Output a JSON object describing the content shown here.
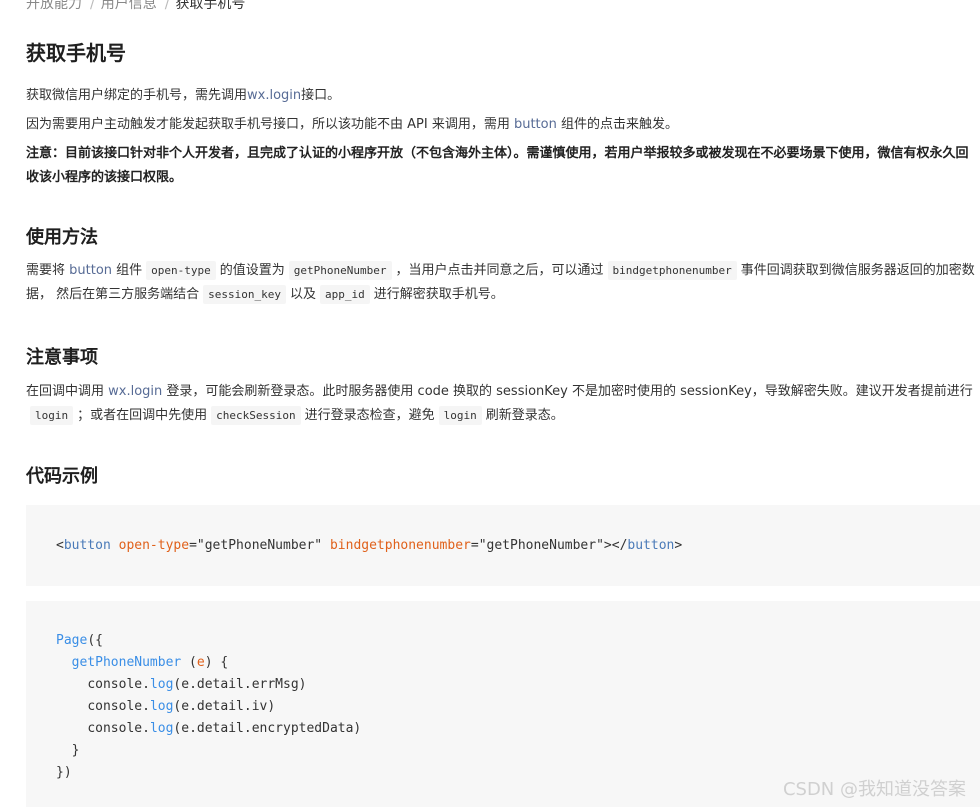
{
  "breadcrumb": {
    "items": [
      "开放能力",
      "用户信息"
    ],
    "current": "获取手机号",
    "separator": "/"
  },
  "page_title": "获取手机号",
  "intro": {
    "p1_before": "获取微信用户绑定的手机号，需先调用",
    "p1_link": "wx.login",
    "p1_after": "接口。",
    "p2_before": "因为需要用户主动触发才能发起获取手机号接口，所以该功能不由 API 来调用，需用 ",
    "p2_link": "button",
    "p2_after": " 组件的点击来触发。",
    "note": "注意：目前该接口针对非个人开发者，且完成了认证的小程序开放（不包含海外主体）。需谨慎使用，若用户举报较多或被发现在不必要场景下使用，微信有权永久回收该小程序的该接口权限。"
  },
  "usage": {
    "heading": "使用方法",
    "t1": "需要将 ",
    "link_button": "button",
    "t2": " 组件",
    "code_open_type": "open-type",
    "t3": "的值设置为",
    "code_get_phone": "getPhoneNumber",
    "t4": "，当用户点击并同意之后，可以通过",
    "code_bind": "bindgetphonenumber",
    "t5": "事件回调获取到微信服务器返回的加密数据， 然后在第三方服务端结合",
    "code_session_key": "session_key",
    "t6": "以及",
    "code_app_id": "app_id",
    "t7": "进行解密获取手机号。"
  },
  "notes": {
    "heading": "注意事项",
    "t1": "在回调中调用 ",
    "link_login": "wx.login",
    "t2": " 登录，可能会刷新登录态。此时服务器使用 code 换取的 sessionKey 不是加密时使用的 sessionKey，导致解密失败。建议开发者提前进行",
    "code_login": "login",
    "t3": "；或者在回调中先使用",
    "code_check": "checkSession",
    "t4": "进行登录态检查，避免",
    "code_login2": "login",
    "t5": "刷新登录态。"
  },
  "example": {
    "heading": "代码示例",
    "wxml": {
      "lt": "<",
      "tag": "button",
      "attr1": "open-type",
      "eq1": "=",
      "val1": "\"getPhoneNumber\"",
      "attr2": "bindgetphonenumber",
      "eq2": "=",
      "val2": "\"getPhoneNumber\"",
      "close_open": "></",
      "gt": ">"
    },
    "js": {
      "page": "Page",
      "page_open": "({",
      "fn": "getPhoneNumber",
      "paren_open": " (",
      "param": "e",
      "paren_close": ") {",
      "l1_a": "console.",
      "l1_m": "log",
      "l1_b": "(e.detail.errMsg)",
      "l2_a": "console.",
      "l2_m": "log",
      "l2_b": "(e.detail.iv)",
      "l3_a": "console.",
      "l3_m": "log",
      "l3_b": "(e.detail.encryptedData)",
      "close_fn": "}",
      "close_page": "})"
    }
  },
  "watermark": "CSDN @我知道没答案",
  "colors": {
    "link": "#576b95",
    "code_bg": "#f7f7f7",
    "keyword_tag": "#4a7ab8",
    "keyword_attr": "#e0611b",
    "keyword_fn": "#3a8ee6"
  }
}
